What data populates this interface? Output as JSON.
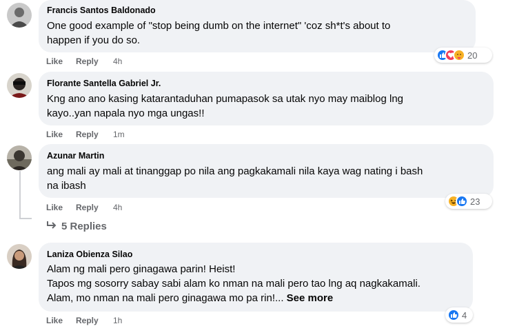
{
  "comments": [
    {
      "author": "Francis Santos Baldonado",
      "text_lines": [
        "One good example of \"stop being dumb on the internet\" 'coz sh*t's about to",
        "happen if you do so."
      ],
      "like": "Like",
      "reply": "Reply",
      "time": "4h",
      "reactions": [
        "like-icon",
        "love-icon",
        "care-icon"
      ],
      "reaction_count": "20"
    },
    {
      "author": "Florante Santella Gabriel Jr.",
      "text_lines": [
        "Kng ano ano kasing katarantaduhan pumapasok sa utak nyo may maiblog lng",
        "kayo..yan napala nyo mga ungas!!"
      ],
      "like": "Like",
      "reply": "Reply",
      "time": "1m"
    },
    {
      "author": "Azunar Martin",
      "text_lines": [
        "ang mali ay mali at tinanggap po nila ang pagkakamali nila kaya wag nating i bash",
        "na ibash"
      ],
      "like": "Like",
      "reply": "Reply",
      "time": "4h",
      "reactions": [
        "haha-icon",
        "like-icon"
      ],
      "reaction_count": "23",
      "replies_label": "5 Replies"
    },
    {
      "author": "Laniza Obienza Silao",
      "text_lines": [
        "Alam ng mali pero ginagawa parin! Heist!",
        "Tapos mg sosorry sabay sabi alam ko nman na mali pero tao lng aq nagkakamali.",
        "Alam, mo nman na mali pero ginagawa mo pa rin!..."
      ],
      "see_more": "See more",
      "like": "Like",
      "reply": "Reply",
      "time": "1h",
      "reactions": [
        "like-icon"
      ],
      "reaction_count": "4"
    }
  ],
  "colors": {
    "bubble": "#f0f2f5",
    "muted_text": "#65676b",
    "like_blue": "#1877f2",
    "love_red": "#f33e58",
    "care_yellow": "#f7b125"
  }
}
